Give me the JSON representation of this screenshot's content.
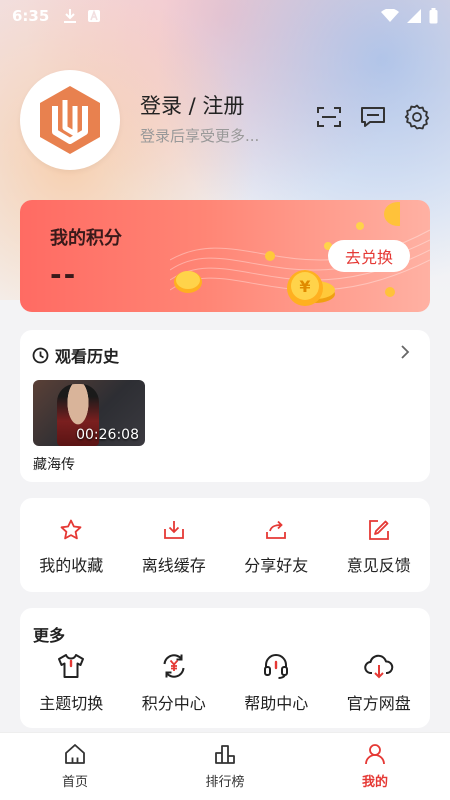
{
  "status_bar": {
    "time": "6:35"
  },
  "profile": {
    "title": "登录 / 注册",
    "subtitle": "登录后享受更多..."
  },
  "top_actions": [
    {
      "icon": "scan-icon"
    },
    {
      "icon": "message-icon"
    },
    {
      "icon": "gear-icon"
    }
  ],
  "points": {
    "title": "我的积分",
    "value": "--",
    "redeem_label": "去兑换"
  },
  "history": {
    "title": "观看历史",
    "items": [
      {
        "title": "藏海传",
        "duration": "00:26:08"
      }
    ]
  },
  "actions": [
    {
      "label": "我的收藏",
      "icon": "star-icon"
    },
    {
      "label": "离线缓存",
      "icon": "download-icon"
    },
    {
      "label": "分享好友",
      "icon": "share-icon"
    },
    {
      "label": "意见反馈",
      "icon": "edit-icon"
    }
  ],
  "more": {
    "title": "更多",
    "items": [
      {
        "label": "主题切换",
        "icon": "tshirt-icon"
      },
      {
        "label": "积分中心",
        "icon": "points-refresh-icon"
      },
      {
        "label": "帮助中心",
        "icon": "headset-icon"
      },
      {
        "label": "官方网盘",
        "icon": "cloud-download-icon"
      }
    ]
  },
  "tabs": [
    {
      "label": "首页",
      "icon": "home-icon",
      "active": false
    },
    {
      "label": "排行榜",
      "icon": "ranking-icon",
      "active": false
    },
    {
      "label": "我的",
      "icon": "user-icon",
      "active": true
    }
  ],
  "colors": {
    "accent": "#e53935",
    "points_gradient_start": "#ff6b63",
    "points_gradient_end": "#ffb1a3"
  }
}
